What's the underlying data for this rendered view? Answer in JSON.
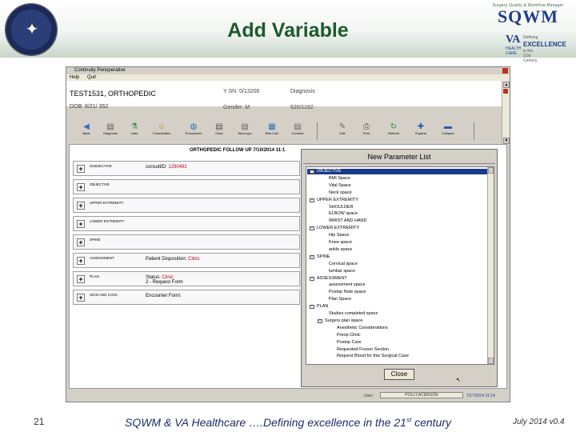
{
  "slide": {
    "title": "Add Variable",
    "page_number": "21",
    "footer_text": "SQWM & VA Healthcare ….Defining excellence in the 21",
    "footer_sup": "st",
    "footer_tail": " century",
    "version": "July 2014  v0.4"
  },
  "logo": {
    "tagline": "Surgery Quality & Workflow Manager",
    "name": "SQWM",
    "va": "VA",
    "va_caption": "HEALTH CARE",
    "defining": "Defining",
    "excellence": "EXCELLENCE",
    "century": "in the 21st Century"
  },
  "window": {
    "title": "Continuity Perioperative",
    "menu": [
      "Help",
      "Quit"
    ],
    "patient_name": "TEST1531, ORTHOPEDIC",
    "dob": "DOB: 8/21/ 352",
    "ssn": "Y SN: 0/13206",
    "diagnosis": "Diagnosis",
    "gender": "Gender: M",
    "mrn": "620/1192"
  },
  "toolbar": [
    {
      "label": "Back",
      "icon": "back-arrow-icon",
      "color": "#3a6fc2"
    },
    {
      "label": "Diagnosis",
      "icon": "document-icon",
      "color": "#5a5a5a"
    },
    {
      "label": "Labs",
      "icon": "flask-icon",
      "color": "#2d8a3a"
    },
    {
      "label": "Consultation",
      "icon": "people-icon",
      "color": "#c08020"
    },
    {
      "label": "Procedures",
      "icon": "globe-icon",
      "color": "#2a6ab8"
    },
    {
      "label": "Clear",
      "icon": "document-icon",
      "color": "#555555"
    },
    {
      "label": "Work-ups",
      "icon": "document-icon",
      "color": "#666666"
    },
    {
      "label": "Risk Calc",
      "icon": "grid-icon",
      "color": "#2a70c0"
    },
    {
      "label": "Consent",
      "icon": "document-icon",
      "color": "#666666"
    },
    {
      "label": "Edit",
      "icon": "pencil-icon",
      "color": "#666666"
    },
    {
      "label": "Print",
      "icon": "printer-icon",
      "color": "#555555"
    },
    {
      "label": "Refresh",
      "icon": "refresh-icon",
      "color": "#2a8a3a"
    },
    {
      "label": "Expand",
      "icon": "plus-icon",
      "color": "#2a5ab0"
    },
    {
      "label": "Collapse",
      "icon": "minus-icon",
      "color": "#2a5ab0"
    }
  ],
  "note_header": "ORTHOPEDIC  FOLLOW UP 7/10/2014 11:1",
  "sections": [
    {
      "name": "SUBJECTIVE",
      "value_label": "consultID: ",
      "value_red": "1290492",
      "value2": ""
    },
    {
      "name": "OBJECTIVE",
      "value_label": "",
      "value_red": "",
      "value2": ""
    },
    {
      "name": "UPPER EXTREMITY",
      "value_label": "",
      "value_red": "",
      "value2": ""
    },
    {
      "name": "LOWER EXTREMITY",
      "value_label": "",
      "value_red": "",
      "value2": ""
    },
    {
      "name": "SPINE",
      "value_label": "",
      "value_red": "",
      "value2": ""
    },
    {
      "name": "ASSESSMENT",
      "value_label": "Patient Disposition: ",
      "value_red": "Clinic",
      "value2": ""
    },
    {
      "name": "PLAN",
      "value_label": "Status: ",
      "value_red": "Clinic",
      "value2": "2 - Request Form"
    },
    {
      "name": "SIGN AND LOCK",
      "value_label": "Encounter Form:",
      "value_red": "",
      "value2": ""
    }
  ],
  "dialog": {
    "title": "New Parameter List",
    "close_label": "Close",
    "tree": [
      {
        "label": "OBJECTIVE",
        "level": 0,
        "expander": "-"
      },
      {
        "label": "BMI Space",
        "level": 1,
        "expander": ""
      },
      {
        "label": "Vital Space",
        "level": 1,
        "expander": ""
      },
      {
        "label": "Neck space",
        "level": 1,
        "expander": ""
      },
      {
        "label": "UPPER EXTREMITY",
        "level": 0,
        "expander": "-"
      },
      {
        "label": "SHOULDER",
        "level": 1,
        "expander": ""
      },
      {
        "label": "ELBOW space",
        "level": 1,
        "expander": ""
      },
      {
        "label": "WRIST AND HAND",
        "level": 1,
        "expander": ""
      },
      {
        "label": "LOWER EXTREMITY",
        "level": 0,
        "expander": "-"
      },
      {
        "label": "Hip Space",
        "level": 1,
        "expander": ""
      },
      {
        "label": "Knee space",
        "level": 1,
        "expander": ""
      },
      {
        "label": "ankle space",
        "level": 1,
        "expander": ""
      },
      {
        "label": "SPINE",
        "level": 0,
        "expander": "-"
      },
      {
        "label": "Cervical space",
        "level": 1,
        "expander": ""
      },
      {
        "label": "lumbar space",
        "level": 1,
        "expander": ""
      },
      {
        "label": "ASSESSMENT",
        "level": 0,
        "expander": "-"
      },
      {
        "label": "assessment space",
        "level": 1,
        "expander": ""
      },
      {
        "label": "Postop Note space",
        "level": 1,
        "expander": ""
      },
      {
        "label": "Plan Space",
        "level": 1,
        "expander": ""
      },
      {
        "label": "PLAN",
        "level": 0,
        "expander": "-"
      },
      {
        "label": "Studies completed space",
        "level": 1,
        "expander": ""
      },
      {
        "label": "Surgery plan space",
        "level": 1,
        "expander": "-"
      },
      {
        "label": "Anesthetic Considerations",
        "level": 2,
        "expander": ""
      },
      {
        "label": "Preop Clinic",
        "level": 2,
        "expander": ""
      },
      {
        "label": "Postop Care",
        "level": 2,
        "expander": ""
      },
      {
        "label": "Requested Frozen Section",
        "level": 2,
        "expander": ""
      },
      {
        "label": "Request Blood for this Surgical Case",
        "level": 2,
        "expander": ""
      }
    ]
  },
  "status": {
    "user_label": "User:",
    "user_value": "POLLY,ACERSON",
    "timestamp": "7/17/2014 11:14"
  },
  "colors": {
    "title_green": "#1d5a2c",
    "footer_blue": "#1d2d6e",
    "selection_blue": "#1c3a8c",
    "alert_red": "#c0001a"
  }
}
